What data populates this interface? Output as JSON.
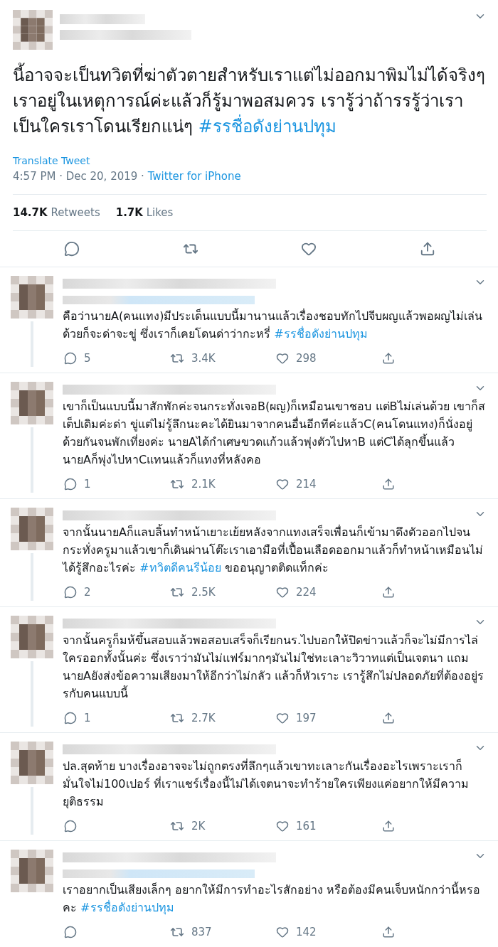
{
  "tweet": {
    "text": [
      {
        "kind": "plain",
        "text": "นี้อาจจะเป็นทวิตที่ฆ่าตัวตายสำหรับเราแต่ไม่ออกมาพิมไม่ได้จริงๆ เราอยู่ในเหตุการณ์ค่ะแล้วก็รู้มาพอสมควร เรารู้ว่าถ้ารรรู้ว่าเราเป็นใครเราโดนเรียกแน่ๆ "
      },
      {
        "kind": "hashtag",
        "text": "#รรชื่อดังย่านปทุม"
      }
    ],
    "translate": "Translate Tweet",
    "time": "4:57 PM · Dec 20, 2019 · ",
    "source": "Twitter for iPhone",
    "stats": [
      {
        "count": "14.7K",
        "label": "Retweets"
      },
      {
        "count": "1.7K",
        "label": "Likes"
      }
    ]
  },
  "replies": [
    {
      "context_line": true,
      "text": [
        {
          "kind": "plain",
          "text": "คือว่านายA(คนแทง)มีประเด็นแบบนี้มานานแล้วเรื่องชอบทักไปจีบผญแล้วพอผญไม่เล่นด้วยก็จะด่าจะขู่ ซึ่งเราก็เคยโดนด่าว่ากะหรี่ "
        },
        {
          "kind": "hashtag",
          "text": "#รรชื่อดังย่านปทุม"
        }
      ],
      "replies": "5",
      "retweets": "3.4K",
      "likes": "298"
    },
    {
      "context_line": false,
      "text": [
        {
          "kind": "plain",
          "text": "เขาก็เป็นแบบนี้มาสักพักค่ะจนกระทั่งเจอB(ผญ)ก็เหมือนเขาชอบ แต่Bไม่เล่นด้วย เขาก็สเต็ปเดิมค่ะด่า ขู่แต่ไม่รู้ลึกนะคะได้ยินมาจากคนอื่นอีกทีค่ะแล้วC(คนโดนแทง)ก็นั่งอยู่ด้วยกันจนพักเที่ยงค่ะ นายAได้กำเศษขวดแก้วแล้วพุ่งตัวไปหาB แต่Cได้ลุกขึ้นแล้วนายAก็พุ่งไปหาCแทนแล้วก็แทงที่หลังคอ"
        }
      ],
      "replies": "1",
      "retweets": "2.1K",
      "likes": "214"
    },
    {
      "context_line": false,
      "text": [
        {
          "kind": "plain",
          "text": "จากนั้นนายAก็แลบลิ้นทำหน้าเยาะเย้ยหลังจากแทงเสร็จเพื่อนก็เข้ามาดึงตัวออกไปจนกระทั่งครูมาแล้วเขาก็เดินผ่านโต๊ะเราเอามือที่เปื้อนเลือดออกมาแล้วก็ทำหน้าเหมือนไม่ได้รู้สึกอะไรค่ะ "
        },
        {
          "kind": "hashtag",
          "text": "#ทวิตดีคนรีน้อย"
        },
        {
          "kind": "plain",
          "text": "  ขออนุญาตติดแท็กค่ะ"
        }
      ],
      "replies": "2",
      "retweets": "2.5K",
      "likes": "224"
    },
    {
      "context_line": false,
      "text": [
        {
          "kind": "plain",
          "text": "จากนั้นครูก็มห้ขึ้นสอบแล้วพอสอบเสร็จก็เรียกนร.ไปบอกให้ปิดข่าวแล้วก็จะไม่มีการไล่ใครออกทั้งนั้นค่ะ ซึ่งเราว่ามันไม่แฟร์มากๆมันไม่ใช่ทะเลาะวิวาทแต่เป็นเจตนา แถมนายAยังส่งข้อความเสียงมาให้อีกว่าไม่กลัว แล้วก็หัวเราะ เรารู้สึกไม่ปลอดภัยที่ต้องอยู่รรกับคนแบบนี้"
        }
      ],
      "replies": "1",
      "retweets": "2.7K",
      "likes": "197"
    },
    {
      "context_line": false,
      "text": [
        {
          "kind": "plain",
          "text": "ปล.สุดท้าย บางเรื่องอาจจะไม่ถูกตรงที่ลึกๆแล้วเขาทะเลาะกันเรื่องอะไรเพราะเราก็มั่นใจไม่100เปอร์ ที่เราแชร์เรื่องนี้ไม่ได้เจตนาจะทำร้ายใครเพียงแค่อยากให้มีความยุติธรรม"
        }
      ],
      "retweets": "2K",
      "likes": "161"
    },
    {
      "context_line": true,
      "text": [
        {
          "kind": "plain",
          "text": "เราอยากเป็นเสียงเล็กๆ อยากให้มีการทำอะไรสักอย่าง หรือต้องมีคนเจ็บหนักกว่านี้หรอคะ "
        },
        {
          "kind": "hashtag",
          "text": "#รรชื่อดังย่านปทุม"
        }
      ],
      "retweets": "837",
      "likes": "142"
    }
  ]
}
